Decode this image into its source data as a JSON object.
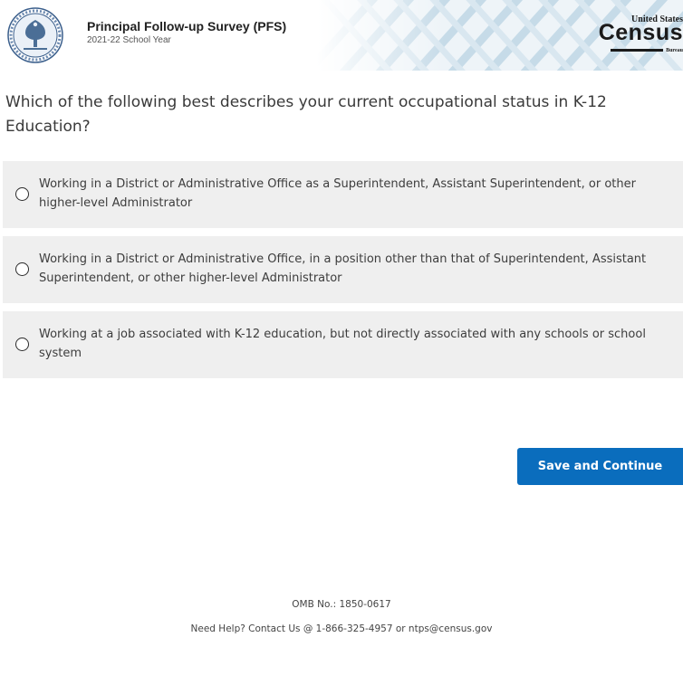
{
  "header": {
    "survey_title": "Principal Follow-up Survey (PFS)",
    "school_year": "2021-22 School Year",
    "logo": {
      "top_text": "United States",
      "main_text": "Census",
      "bottom_text": "Bureau"
    }
  },
  "question": {
    "text": "Which of the following best describes your current occupational status in K-12 Education?"
  },
  "options": [
    {
      "label": "Working in a District or Administrative Office as a Superintendent, Assistant Superintendent, or other higher-level Administrator",
      "selected": false
    },
    {
      "label": "Working in a District or Administrative Office, in a position other than that of Superintendent, Assistant Superintendent, or other higher-level Administrator",
      "selected": false
    },
    {
      "label": "Working at a job associated with K-12 education, but not directly associated with any schools or school system",
      "selected": false
    }
  ],
  "actions": {
    "save_continue_label": "Save and Continue"
  },
  "footer": {
    "omb": "OMB No.: 1850-0617",
    "help": "Need Help? Contact Us @ 1-866-325-4957 or ntps@census.gov"
  },
  "colors": {
    "primary_button": "#0a6dbd",
    "option_background": "#efefef"
  }
}
